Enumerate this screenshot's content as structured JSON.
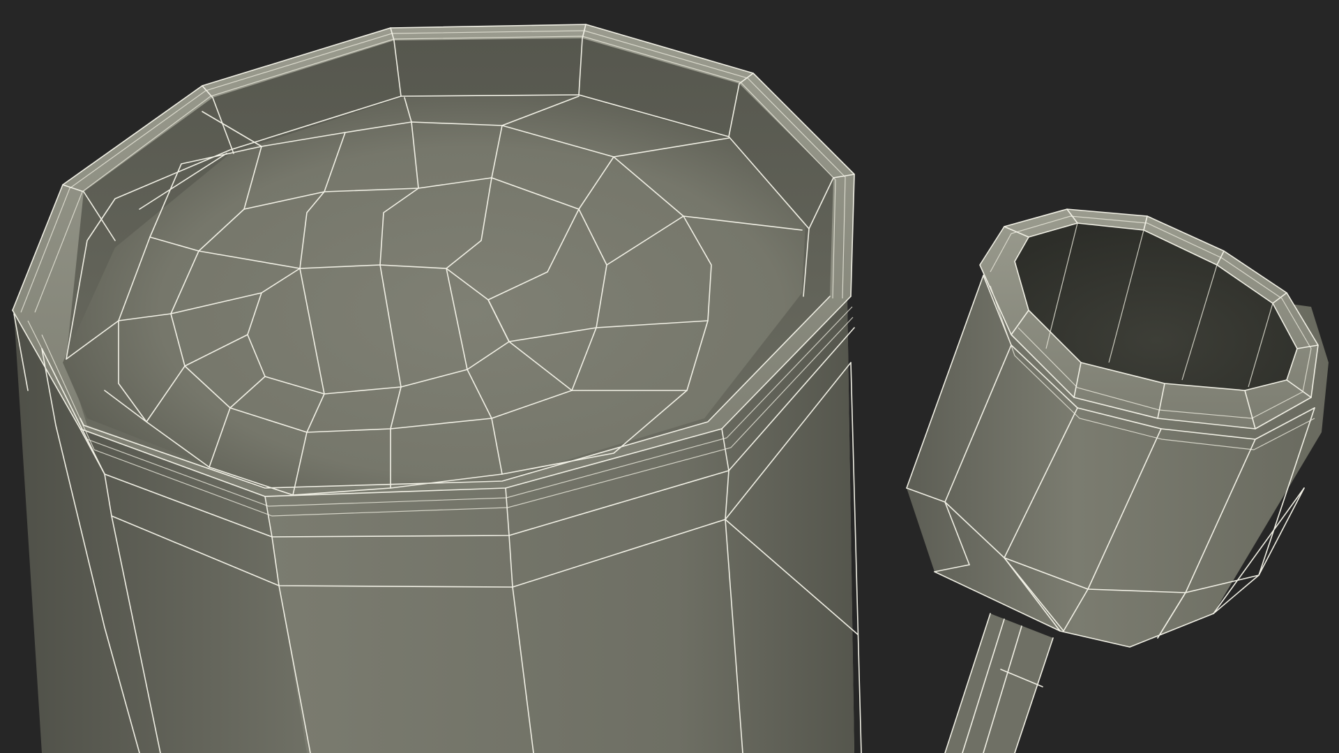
{
  "scene": {
    "background": "#262626",
    "surface_color": "#7b7c70",
    "wire_color": "#f2f1e6",
    "objects": [
      {
        "name": "large-octagonal-cup"
      },
      {
        "name": "small-octagonal-ladle-cup"
      }
    ]
  }
}
